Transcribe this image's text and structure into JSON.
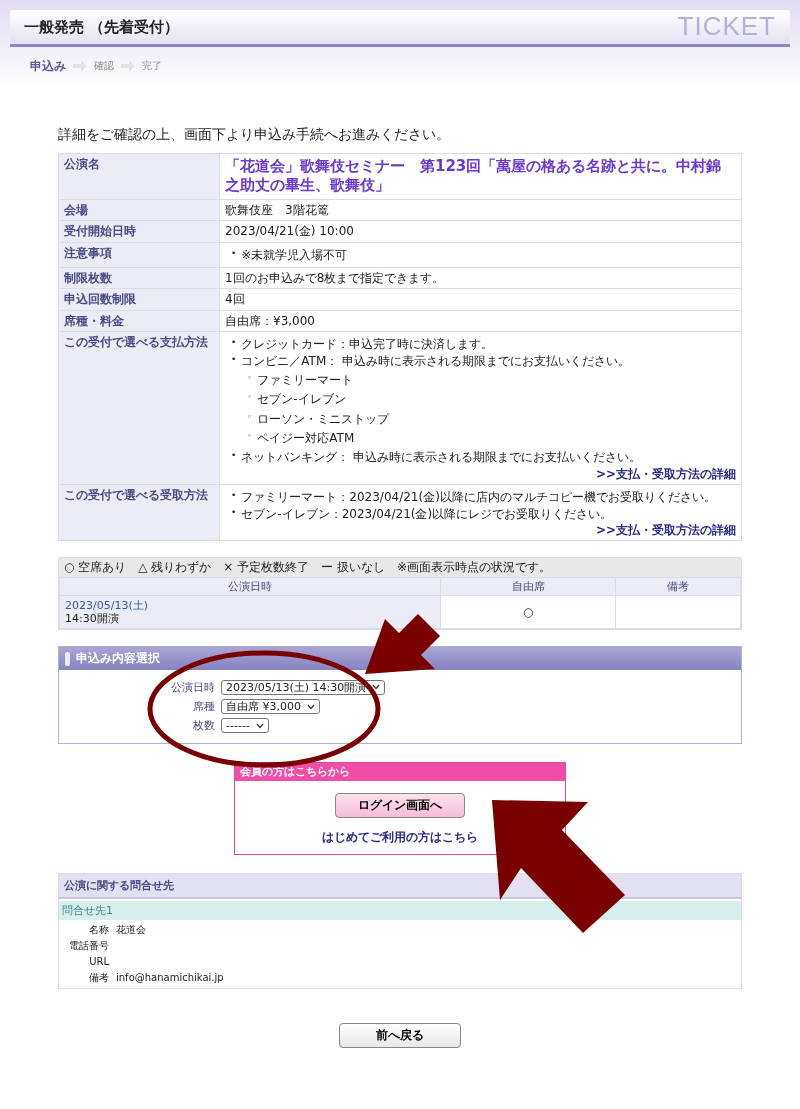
{
  "page_title": "一般発売 （先着受付）",
  "header_logo": "TICKET",
  "steps": [
    {
      "label": "申込み",
      "selected": true
    },
    {
      "label": "確認",
      "selected": false
    },
    {
      "label": "完了",
      "selected": false
    }
  ],
  "intro": "詳細をご確認の上、画面下より申込み手続へお進みください。",
  "details": [
    {
      "label": "公演名",
      "kind": "title",
      "value": "「花道会」歌舞伎セミナー　第123回「萬屋の格ある名跡と共に。中村錦之助丈の畢生、歌舞伎」"
    },
    {
      "label": "会場",
      "kind": "text",
      "value": "歌舞伎座　3階花篭"
    },
    {
      "label": "受付開始日時",
      "kind": "text",
      "value": "2023/04/21(金) 10:00"
    },
    {
      "label": "注意事項",
      "kind": "list",
      "items": [
        {
          "marker": "•",
          "text": "※未就学児入場不可"
        }
      ]
    },
    {
      "label": "制限枚数",
      "kind": "text",
      "value": "1回のお申込みで8枚まで指定できます。"
    },
    {
      "label": "申込回数制限",
      "kind": "text",
      "value": "4回"
    },
    {
      "label": "席種・料金",
      "kind": "text",
      "value": "自由席：¥3,000"
    },
    {
      "label": "この受付で選べる支払方法",
      "kind": "list",
      "items": [
        {
          "marker": "•",
          "text": "クレジットカード：申込完了時に決済します。"
        },
        {
          "marker": "•",
          "text": "コンビニ／ATM：  申込み時に表示される期限までにお支払いください。",
          "children": [
            {
              "marker": "◦",
              "text": "ファミリーマート"
            },
            {
              "marker": "◦",
              "text": "セブン‐イレブン"
            },
            {
              "marker": "◦",
              "text": "ローソン・ミニストップ"
            },
            {
              "marker": "◦",
              "text": "ペイジー対応ATM"
            }
          ]
        },
        {
          "marker": "•",
          "text": "ネットバンキング：  申込み時に表示される期限までにお支払いください。"
        }
      ],
      "link": ">>支払・受取方法の詳細"
    },
    {
      "label": "この受付で選べる受取方法",
      "kind": "list",
      "items": [
        {
          "marker": "•",
          "text": "ファミリーマート：2023/04/21(金)以降に店内のマルチコピー機でお受取りください。"
        },
        {
          "marker": "•",
          "text": "セブン‐イレブン：2023/04/21(金)以降にレジでお受取りください。"
        }
      ],
      "link": ">>支払・受取方法の詳細"
    }
  ],
  "availability": {
    "legend": "○ 空席あり　△ 残りわずか　× 予定枚数終了　ー 扱いなし　※画面表示時点の状況です。",
    "columns": [
      "公演日時",
      "自由席",
      "備考"
    ],
    "rows": [
      {
        "date": "2023/05/13(土)",
        "time": "14:30開演",
        "seat": "○"
      }
    ]
  },
  "selection": {
    "title": "申込み内容選択",
    "fields": [
      {
        "label": "公演日時",
        "value": "2023/05/13(土) 14:30開演"
      },
      {
        "label": "席種",
        "value": "自由席 ¥3,000"
      },
      {
        "label": "枚数",
        "value": "------"
      }
    ]
  },
  "member": {
    "title": "会員の方はこちらから",
    "login_button": "ログイン画面へ",
    "register_link": "はじめてご利用の方はこちら"
  },
  "inquiry": {
    "title": "公演に関する問合せ先",
    "subtitle": "問合せ先1",
    "rows": [
      {
        "label": "名称",
        "value": "花道会"
      },
      {
        "label": "電話番号"
      },
      {
        "label": "URL"
      },
      {
        "label": "備考",
        "value": "info@hanamichikai.jp"
      }
    ]
  },
  "back_button": "前へ戻る"
}
